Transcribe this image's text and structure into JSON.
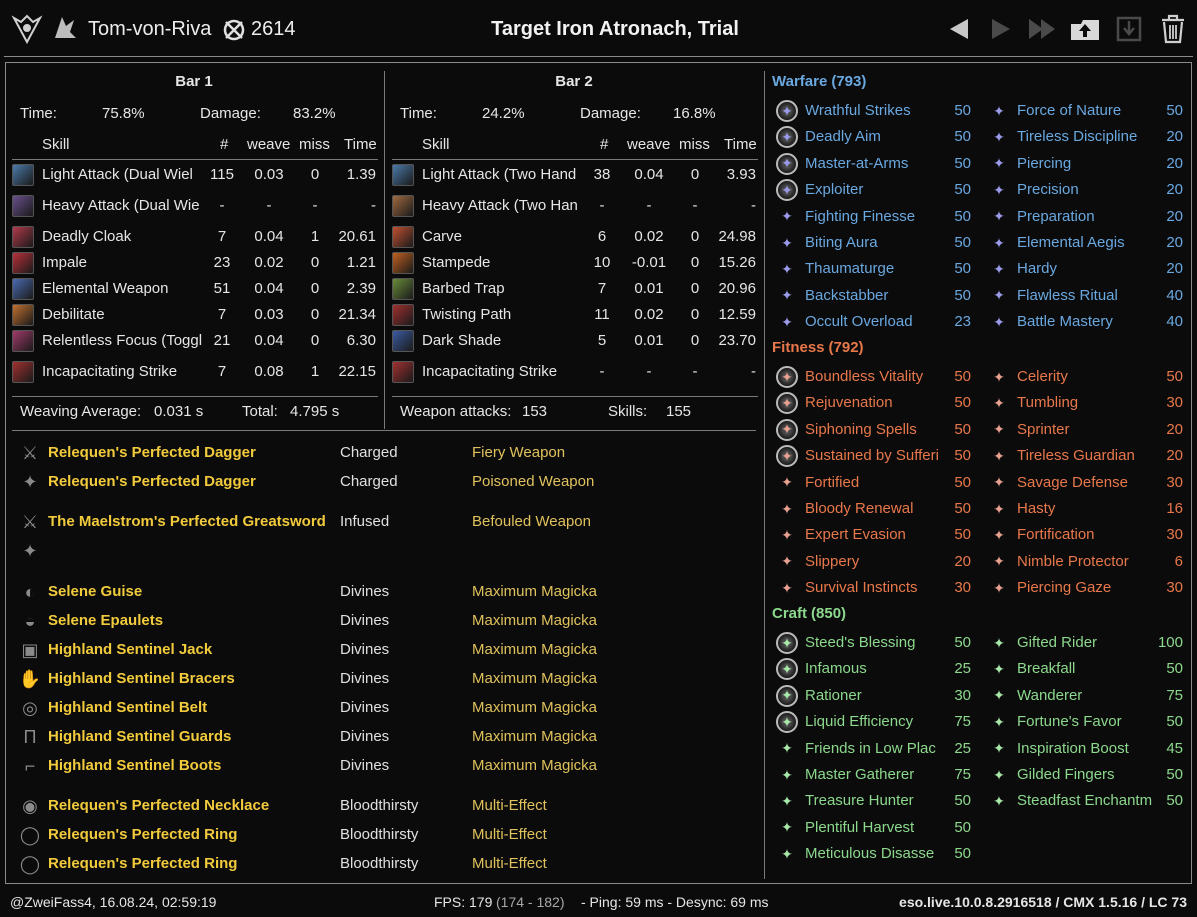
{
  "header": {
    "player_name": "Tom-von-Riva",
    "champion_points": "2614",
    "fight_title": "Target Iron Atronach, Trial",
    "icons": [
      "class-icon",
      "race-icon",
      "champion-icon",
      "previous-icon",
      "next-icon",
      "last-icon",
      "upload-icon",
      "save-icon",
      "delete-icon"
    ]
  },
  "bars": [
    {
      "title": "Bar 1",
      "time_label": "Time:",
      "time_value": "75.8%",
      "damage_label": "Damage:",
      "damage_value": "83.2%",
      "columns": [
        "Skill",
        "#",
        "weave",
        "miss",
        "Time"
      ],
      "skills": [
        {
          "name": "Light Attack (Dual Wiel",
          "count": "115",
          "weave": "0.03",
          "miss": "0",
          "time": "1.39",
          "color": "#4a7aa8"
        },
        {
          "name": "Heavy Attack (Dual Wie",
          "count": "-",
          "weave": "-",
          "miss": "-",
          "time": "-",
          "color": "#6a4f8c"
        },
        {
          "name": "Deadly Cloak",
          "count": "7",
          "weave": "0.04",
          "miss": "1",
          "time": "20.61",
          "color": "#b03a4a"
        },
        {
          "name": "Impale",
          "count": "23",
          "weave": "0.02",
          "miss": "0",
          "time": "1.21",
          "color": "#b8303a"
        },
        {
          "name": "Elemental Weapon",
          "count": "51",
          "weave": "0.04",
          "miss": "0",
          "time": "2.39",
          "color": "#4a6ab0"
        },
        {
          "name": "Debilitate",
          "count": "7",
          "weave": "0.03",
          "miss": "0",
          "time": "21.34",
          "color": "#c07030"
        },
        {
          "name": "Relentless Focus (Toggl",
          "count": "21",
          "weave": "0.04",
          "miss": "0",
          "time": "6.30",
          "color": "#a03a6a"
        },
        {
          "name": "Incapacitating Strike",
          "count": "7",
          "weave": "0.08",
          "miss": "1",
          "time": "22.15",
          "color": "#a03030"
        }
      ],
      "footer_left_label": "Weaving Average:",
      "footer_left_value": "0.031 s",
      "footer_right_label": "Total:",
      "footer_right_value": "4.795 s"
    },
    {
      "title": "Bar 2",
      "time_label": "Time:",
      "time_value": "24.2%",
      "damage_label": "Damage:",
      "damage_value": "16.8%",
      "columns": [
        "Skill",
        "#",
        "weave",
        "miss",
        "Time"
      ],
      "skills": [
        {
          "name": "Light Attack (Two Hand",
          "count": "38",
          "weave": "0.04",
          "miss": "0",
          "time": "3.93",
          "color": "#4a7aa8"
        },
        {
          "name": "Heavy Attack (Two Han",
          "count": "-",
          "weave": "-",
          "miss": "-",
          "time": "-",
          "color": "#a06a40"
        },
        {
          "name": "Carve",
          "count": "6",
          "weave": "0.02",
          "miss": "0",
          "time": "24.98",
          "color": "#c05030"
        },
        {
          "name": "Stampede",
          "count": "10",
          "weave": "-0.01",
          "miss": "0",
          "time": "15.26",
          "color": "#c06020"
        },
        {
          "name": "Barbed Trap",
          "count": "7",
          "weave": "0.01",
          "miss": "0",
          "time": "20.96",
          "color": "#6a8a3a"
        },
        {
          "name": "Twisting Path",
          "count": "11",
          "weave": "0.02",
          "miss": "0",
          "time": "12.59",
          "color": "#a03030"
        },
        {
          "name": "Dark Shade",
          "count": "5",
          "weave": "0.01",
          "miss": "0",
          "time": "23.70",
          "color": "#3a5aa0"
        },
        {
          "name": "Incapacitating Strike",
          "count": "-",
          "weave": "-",
          "miss": "-",
          "time": "-",
          "color": "#a03030"
        }
      ],
      "footer_left_label": "Weapon attacks:",
      "footer_left_value": "153",
      "footer_right_label": "Skills:",
      "footer_right_value": "155"
    }
  ],
  "gear": [
    {
      "name": "Relequen's Perfected Dagger",
      "trait": "Charged",
      "enchant": "Fiery Weapon",
      "icon": "dagger-icon",
      "glyph": "⚔"
    },
    {
      "name": "Relequen's Perfected Dagger",
      "trait": "Charged",
      "enchant": "Poisoned Weapon",
      "icon": "dagger-icon",
      "glyph": "✦"
    },
    {
      "name": "The Maelstrom's Perfected Greatsword",
      "trait": "Infused",
      "enchant": "Befouled Weapon",
      "icon": "greatsword-icon",
      "glyph": "⚔"
    },
    {
      "name": "",
      "trait": "",
      "enchant": "",
      "icon": "empty-slot-icon",
      "glyph": "✦"
    },
    {
      "name": "Selene Guise",
      "trait": "Divines",
      "enchant": "Maximum Magicka",
      "icon": "helmet-icon",
      "glyph": "◐"
    },
    {
      "name": "Selene Epaulets",
      "trait": "Divines",
      "enchant": "Maximum Magicka",
      "icon": "shoulders-icon",
      "glyph": "◒"
    },
    {
      "name": "Highland Sentinel Jack",
      "trait": "Divines",
      "enchant": "Maximum Magicka",
      "icon": "chest-icon",
      "glyph": "▣"
    },
    {
      "name": "Highland Sentinel Bracers",
      "trait": "Divines",
      "enchant": "Maximum Magicka",
      "icon": "gloves-icon",
      "glyph": "✋"
    },
    {
      "name": "Highland Sentinel Belt",
      "trait": "Divines",
      "enchant": "Maximum Magicka",
      "icon": "belt-icon",
      "glyph": "◎"
    },
    {
      "name": "Highland Sentinel Guards",
      "trait": "Divines",
      "enchant": "Maximum Magicka",
      "icon": "legs-icon",
      "glyph": "Π"
    },
    {
      "name": "Highland Sentinel Boots",
      "trait": "Divines",
      "enchant": "Maximum Magicka",
      "icon": "boots-icon",
      "glyph": "⌐"
    },
    {
      "name": "Relequen's Perfected Necklace",
      "trait": "Bloodthirsty",
      "enchant": "Multi-Effect",
      "icon": "necklace-icon",
      "glyph": "◉"
    },
    {
      "name": "Relequen's Perfected Ring",
      "trait": "Bloodthirsty",
      "enchant": "Multi-Effect",
      "icon": "ring-icon",
      "glyph": "◯"
    },
    {
      "name": "Relequen's Perfected Ring",
      "trait": "Bloodthirsty",
      "enchant": "Multi-Effect",
      "icon": "ring-icon",
      "glyph": "◯"
    }
  ],
  "champion": [
    {
      "tree": "Warfare",
      "total": "(793)",
      "color": "#6aa8e0",
      "star_color": "#9a9ae8",
      "left": [
        {
          "name": "Wrathful Strikes",
          "value": "50",
          "slotted": true
        },
        {
          "name": "Deadly Aim",
          "value": "50",
          "slotted": true
        },
        {
          "name": "Master-at-Arms",
          "value": "50",
          "slotted": true
        },
        {
          "name": "Exploiter",
          "value": "50",
          "slotted": true
        },
        {
          "name": "Fighting Finesse",
          "value": "50",
          "slotted": false
        },
        {
          "name": "Biting Aura",
          "value": "50",
          "slotted": false
        },
        {
          "name": "Thaumaturge",
          "value": "50",
          "slotted": false
        },
        {
          "name": "Backstabber",
          "value": "50",
          "slotted": false
        },
        {
          "name": "Occult Overload",
          "value": "23",
          "slotted": false
        }
      ],
      "right": [
        {
          "name": "Force of Nature",
          "value": "50"
        },
        {
          "name": "Tireless Discipline",
          "value": "20"
        },
        {
          "name": "Piercing",
          "value": "20"
        },
        {
          "name": "Precision",
          "value": "20"
        },
        {
          "name": "Preparation",
          "value": "20"
        },
        {
          "name": "Elemental Aegis",
          "value": "20"
        },
        {
          "name": "Hardy",
          "value": "20"
        },
        {
          "name": "Flawless Ritual",
          "value": "40"
        },
        {
          "name": "Battle Mastery",
          "value": "40"
        }
      ]
    },
    {
      "tree": "Fitness",
      "total": "(792)",
      "color": "#e8784a",
      "star_color": "#e8a090",
      "left": [
        {
          "name": "Boundless Vitality",
          "value": "50",
          "slotted": true
        },
        {
          "name": "Rejuvenation",
          "value": "50",
          "slotted": true
        },
        {
          "name": "Siphoning Spells",
          "value": "50",
          "slotted": true
        },
        {
          "name": "Sustained by Sufferi",
          "value": "50",
          "slotted": true
        },
        {
          "name": "Fortified",
          "value": "50",
          "slotted": false
        },
        {
          "name": "Bloody Renewal",
          "value": "50",
          "slotted": false
        },
        {
          "name": "Expert Evasion",
          "value": "50",
          "slotted": false
        },
        {
          "name": "Slippery",
          "value": "20",
          "slotted": false
        },
        {
          "name": "Survival Instincts",
          "value": "30",
          "slotted": false
        }
      ],
      "right": [
        {
          "name": "Celerity",
          "value": "50"
        },
        {
          "name": "Tumbling",
          "value": "30"
        },
        {
          "name": "Sprinter",
          "value": "20"
        },
        {
          "name": "Tireless Guardian",
          "value": "20"
        },
        {
          "name": "Savage Defense",
          "value": "30"
        },
        {
          "name": "Hasty",
          "value": "16"
        },
        {
          "name": "Fortification",
          "value": "30"
        },
        {
          "name": "Nimble Protector",
          "value": "6"
        },
        {
          "name": "Piercing Gaze",
          "value": "30"
        }
      ]
    },
    {
      "tree": "Craft",
      "total": "(850)",
      "color": "#8cd88c",
      "star_color": "#a8e8a8",
      "left": [
        {
          "name": "Steed's Blessing",
          "value": "50",
          "slotted": true
        },
        {
          "name": "Infamous",
          "value": "25",
          "slotted": true
        },
        {
          "name": "Rationer",
          "value": "30",
          "slotted": true
        },
        {
          "name": "Liquid Efficiency",
          "value": "75",
          "slotted": true
        },
        {
          "name": "Friends in Low Plac",
          "value": "25",
          "slotted": false
        },
        {
          "name": "Master Gatherer",
          "value": "75",
          "slotted": false
        },
        {
          "name": "Treasure Hunter",
          "value": "50",
          "slotted": false
        },
        {
          "name": "Plentiful Harvest",
          "value": "50",
          "slotted": false
        },
        {
          "name": "Meticulous Disasse",
          "value": "50",
          "slotted": false
        }
      ],
      "right": [
        {
          "name": "Gifted Rider",
          "value": "100"
        },
        {
          "name": "Breakfall",
          "value": "50"
        },
        {
          "name": "Wanderer",
          "value": "75"
        },
        {
          "name": "Fortune's Favor",
          "value": "50"
        },
        {
          "name": "Inspiration Boost",
          "value": "45"
        },
        {
          "name": "Gilded Fingers",
          "value": "50"
        },
        {
          "name": "Steadfast Enchantm",
          "value": "50"
        }
      ]
    }
  ],
  "footer": {
    "author": "@ZweiFass4, 16.08.24, 02:59:19",
    "fps_label": "FPS: 179",
    "fps_range": "(174 - 182)",
    "ping": "- Ping: 59 ms - Desync: 69 ms",
    "version": "eso.live.10.0.8.2916518 / CMX 1.5.16 / LC 73"
  }
}
